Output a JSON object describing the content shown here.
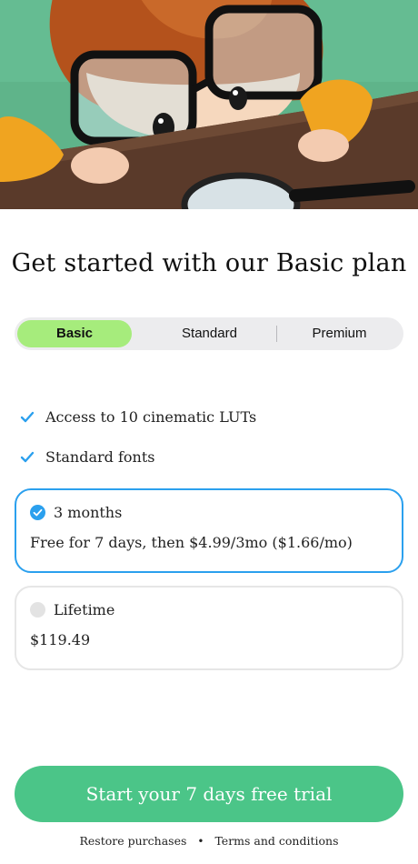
{
  "headline": "Get started with our Basic plan",
  "tabs": [
    {
      "label": "Basic",
      "active": true
    },
    {
      "label": "Standard",
      "active": false
    },
    {
      "label": "Premium",
      "active": false
    }
  ],
  "features": [
    {
      "text": "Access to 10 cinematic LUTs",
      "icon": "check-icon"
    },
    {
      "text": "Standard fonts",
      "icon": "check-icon"
    }
  ],
  "plans": [
    {
      "name": "3 months",
      "price_text": "Free for 7 days, then $4.99/3mo ($1.66/mo)",
      "selected": true
    },
    {
      "name": "Lifetime",
      "price_text": "$119.49",
      "selected": false
    }
  ],
  "cta_label": "Start your 7 days free trial",
  "footer": {
    "restore_label": "Restore purchases",
    "separator": "•",
    "terms_label": "Terms and conditions"
  },
  "colors": {
    "accent_blue": "#2ba0ee",
    "active_tab": "#a6ec7c",
    "cta_green": "#4bc588",
    "hero_background": "#5fb48a"
  }
}
